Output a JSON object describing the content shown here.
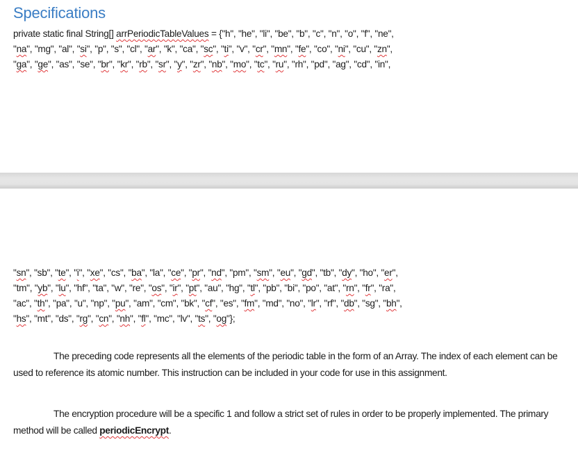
{
  "document": {
    "heading": "Specifications",
    "code_top": {
      "lines": [
        [
          {
            "t": "private static final String[] ",
            "spell": false
          },
          {
            "t": "arrPeriodicTableValues",
            "spell": true
          },
          {
            "t": " = {\"h\", \"he\", \"li\", \"be\", \"b\", \"c\", \"n\", \"o\", \"f\", \"ne\",",
            "spell": false
          }
        ],
        [
          {
            "t": "\"",
            "spell": false
          },
          {
            "t": "na",
            "spell": true
          },
          {
            "t": "\", \"mg\", \"al\", \"",
            "spell": false
          },
          {
            "t": "si",
            "spell": true
          },
          {
            "t": "\", \"p\", \"s\", \"cl\", \"",
            "spell": false
          },
          {
            "t": "ar",
            "spell": true
          },
          {
            "t": "\", \"k\", \"ca\", \"",
            "spell": false
          },
          {
            "t": "sc",
            "spell": true
          },
          {
            "t": "\", \"",
            "spell": false
          },
          {
            "t": "ti",
            "spell": true
          },
          {
            "t": "\", \"v\", \"",
            "spell": false
          },
          {
            "t": "cr",
            "spell": true
          },
          {
            "t": "\", \"",
            "spell": false
          },
          {
            "t": "mn",
            "spell": true
          },
          {
            "t": "\", \"",
            "spell": false
          },
          {
            "t": "fe",
            "spell": true
          },
          {
            "t": "\", \"co\", \"",
            "spell": false
          },
          {
            "t": "ni",
            "spell": true
          },
          {
            "t": "\", \"cu\", \"",
            "spell": false
          },
          {
            "t": "zn",
            "spell": true
          },
          {
            "t": "\",",
            "spell": false
          }
        ],
        [
          {
            "t": "\"",
            "spell": false
          },
          {
            "t": "ga",
            "spell": true
          },
          {
            "t": "\", \"",
            "spell": false
          },
          {
            "t": "ge",
            "spell": true
          },
          {
            "t": "\", \"as\", \"se\", \"",
            "spell": false
          },
          {
            "t": "br",
            "spell": true
          },
          {
            "t": "\", \"",
            "spell": false
          },
          {
            "t": "kr",
            "spell": true
          },
          {
            "t": "\", \"",
            "spell": false
          },
          {
            "t": "rb",
            "spell": true
          },
          {
            "t": "\", \"",
            "spell": false
          },
          {
            "t": "sr",
            "spell": true
          },
          {
            "t": "\", \"",
            "spell": false
          },
          {
            "t": "y",
            "spell": true
          },
          {
            "t": "\", \"",
            "spell": false
          },
          {
            "t": "zr",
            "spell": true
          },
          {
            "t": "\", \"",
            "spell": false
          },
          {
            "t": "nb",
            "spell": true
          },
          {
            "t": "\", \"",
            "spell": false
          },
          {
            "t": "mo",
            "spell": true
          },
          {
            "t": "\", \"",
            "spell": false
          },
          {
            "t": "tc",
            "spell": true
          },
          {
            "t": "\", \"",
            "spell": false
          },
          {
            "t": "ru",
            "spell": true
          },
          {
            "t": "\", \"rh\", \"pd\", \"ag\", \"cd\", \"in\",",
            "spell": false
          }
        ]
      ]
    },
    "code_bottom": {
      "lines": [
        [
          {
            "t": "\"",
            "spell": false
          },
          {
            "t": "sn",
            "spell": true
          },
          {
            "t": "\", \"sb\", \"",
            "spell": false
          },
          {
            "t": "te",
            "spell": true
          },
          {
            "t": "\", \"",
            "spell": false
          },
          {
            "t": "i",
            "spell": true
          },
          {
            "t": "\", \"",
            "spell": false
          },
          {
            "t": "xe",
            "spell": true
          },
          {
            "t": "\", \"cs\", \"",
            "spell": false
          },
          {
            "t": "ba",
            "spell": true
          },
          {
            "t": "\", \"la\", \"",
            "spell": false
          },
          {
            "t": "ce",
            "spell": true
          },
          {
            "t": "\", \"",
            "spell": false
          },
          {
            "t": "pr",
            "spell": true
          },
          {
            "t": "\", \"",
            "spell": false
          },
          {
            "t": "nd",
            "spell": true
          },
          {
            "t": "\", \"pm\", \"",
            "spell": false
          },
          {
            "t": "sm",
            "spell": true
          },
          {
            "t": "\", \"",
            "spell": false
          },
          {
            "t": "eu",
            "spell": true
          },
          {
            "t": "\", \"",
            "spell": false
          },
          {
            "t": "gd",
            "spell": true
          },
          {
            "t": "\", \"tb\", \"",
            "spell": false
          },
          {
            "t": "dy",
            "spell": true
          },
          {
            "t": "\", \"ho\", \"",
            "spell": false
          },
          {
            "t": "er",
            "spell": true
          },
          {
            "t": "\",",
            "spell": false
          }
        ],
        [
          {
            "t": "\"tm\", \"",
            "spell": false
          },
          {
            "t": "yb",
            "spell": true
          },
          {
            "t": "\", \"",
            "spell": false
          },
          {
            "t": "lu",
            "spell": true
          },
          {
            "t": "\", \"hf\", \"ta\", \"w\", \"re\", \"",
            "spell": false
          },
          {
            "t": "os",
            "spell": true
          },
          {
            "t": "\", \"",
            "spell": false
          },
          {
            "t": "ir",
            "spell": true
          },
          {
            "t": "\", \"",
            "spell": false
          },
          {
            "t": "pt",
            "spell": true
          },
          {
            "t": "\", \"au\", \"hg\", \"",
            "spell": false
          },
          {
            "t": "tl",
            "spell": true
          },
          {
            "t": "\", \"pb\", \"bi\", \"po\", \"at\", \"",
            "spell": false
          },
          {
            "t": "rn",
            "spell": true
          },
          {
            "t": "\", \"",
            "spell": false
          },
          {
            "t": "fr",
            "spell": true
          },
          {
            "t": "\", \"ra\",",
            "spell": false
          }
        ],
        [
          {
            "t": "\"ac\", \"",
            "spell": false
          },
          {
            "t": "th",
            "spell": true
          },
          {
            "t": "\", \"pa\", \"u\", \"np\", \"",
            "spell": false
          },
          {
            "t": "pu",
            "spell": true
          },
          {
            "t": "\", \"am\", \"cm\", \"bk\", \"",
            "spell": false
          },
          {
            "t": "cf",
            "spell": true
          },
          {
            "t": "\", \"es\", \"",
            "spell": false
          },
          {
            "t": "fm",
            "spell": true
          },
          {
            "t": "\", \"md\", \"no\", \"",
            "spell": false
          },
          {
            "t": "lr",
            "spell": true
          },
          {
            "t": "\", \"rf\", \"",
            "spell": false
          },
          {
            "t": "db",
            "spell": true
          },
          {
            "t": "\", \"sg\", \"",
            "spell": false
          },
          {
            "t": "bh",
            "spell": true
          },
          {
            "t": "\",",
            "spell": false
          }
        ],
        [
          {
            "t": "\"",
            "spell": false
          },
          {
            "t": "hs",
            "spell": true
          },
          {
            "t": "\", \"mt\", \"ds\", \"",
            "spell": false
          },
          {
            "t": "rg",
            "spell": true
          },
          {
            "t": "\", \"",
            "spell": false
          },
          {
            "t": "cn",
            "spell": true
          },
          {
            "t": "\", \"",
            "spell": false
          },
          {
            "t": "nh",
            "spell": true
          },
          {
            "t": "\", \"",
            "spell": false
          },
          {
            "t": "fl",
            "spell": true
          },
          {
            "t": "\", \"mc\", \"lv\", \"",
            "spell": false
          },
          {
            "t": "ts",
            "spell": true
          },
          {
            "t": "\", \"",
            "spell": false
          },
          {
            "t": "og",
            "spell": true
          },
          {
            "t": "\"};",
            "spell": false
          }
        ]
      ]
    },
    "paragraph_1": "The preceding code represents all the elements of the periodic table in the form of an Array. The index of each element can be used to reference its atomic number. This instruction can be included in your code for use in this assignment.",
    "paragraph_2_prefix": "The encryption procedure will be a specific 1 and follow a strict set of rules in order to be properly implemented. The primary method will be called ",
    "paragraph_2_term": "periodicEncrypt",
    "paragraph_2_suffix": ".",
    "colors": {
      "heading": "#3a7dc4",
      "spellcheck_underline": "#e0383b",
      "page_gap": "#e4e4e4"
    }
  }
}
